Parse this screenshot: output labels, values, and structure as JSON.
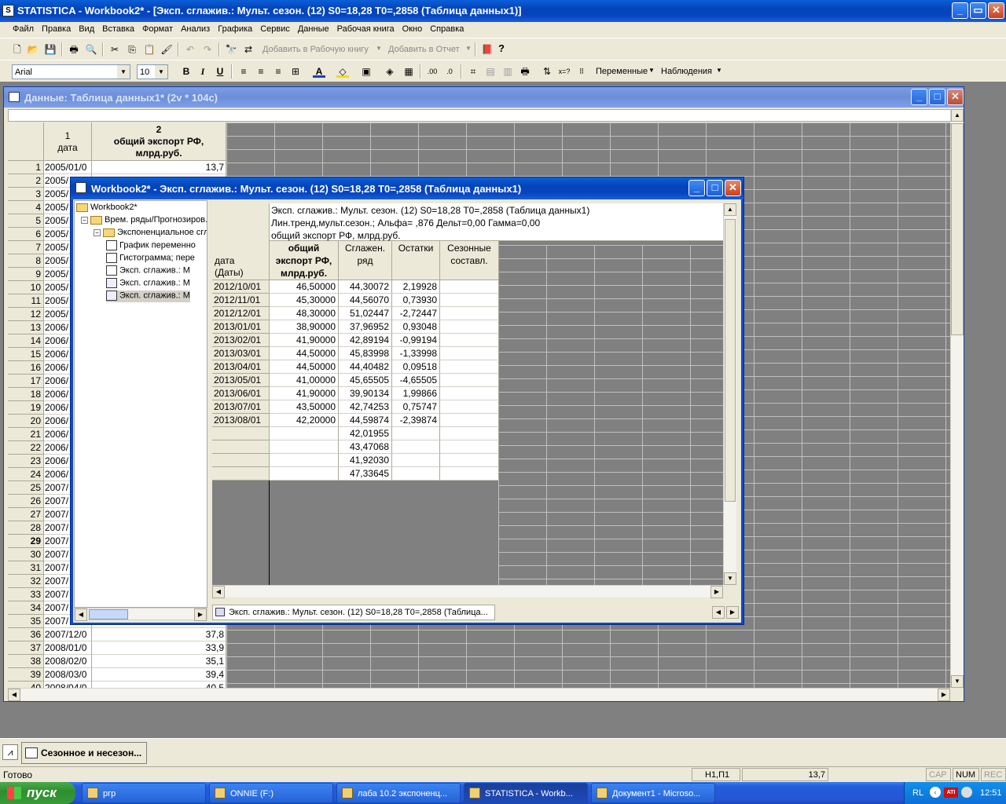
{
  "app": {
    "title": "STATISTICA - Workbook2* - [Эксп. сглажив.: Мульт. сезон. (12) S0=18,28 T0=,2858 (Таблица данных1)]"
  },
  "menu": [
    "Файл",
    "Правка",
    "Вид",
    "Вставка",
    "Формат",
    "Анализ",
    "Графика",
    "Сервис",
    "Данные",
    "Рабочая книга",
    "Окно",
    "Справка"
  ],
  "toolbar": {
    "add_workbook": "Добавить в Рабочую книгу",
    "add_report": "Добавить в Отчет",
    "font": "Arial",
    "size": "10",
    "variables": "Переменные",
    "observations": "Наблюдения",
    "help_icon": "?"
  },
  "datawin": {
    "title": "Данные: Таблица данных1* (2v * 104c)",
    "col1_num": "1",
    "col1_name": "дата",
    "col2_num": "2",
    "col2_name": "общий экспорт РФ, млрд.руб.",
    "rows": [
      [
        "1",
        "2005/01/0",
        "13,7"
      ],
      [
        "2",
        "2005/",
        ""
      ],
      [
        "3",
        "2005/",
        ""
      ],
      [
        "4",
        "2005/",
        ""
      ],
      [
        "5",
        "2005/",
        ""
      ],
      [
        "6",
        "2005/",
        ""
      ],
      [
        "7",
        "2005/",
        ""
      ],
      [
        "8",
        "2005/",
        ""
      ],
      [
        "9",
        "2005/",
        ""
      ],
      [
        "10",
        "2005/",
        ""
      ],
      [
        "11",
        "2005/",
        ""
      ],
      [
        "12",
        "2005/",
        ""
      ],
      [
        "13",
        "2006/",
        ""
      ],
      [
        "14",
        "2006/",
        ""
      ],
      [
        "15",
        "2006/",
        ""
      ],
      [
        "16",
        "2006/",
        ""
      ],
      [
        "17",
        "2006/",
        ""
      ],
      [
        "18",
        "2006/",
        ""
      ],
      [
        "19",
        "2006/",
        ""
      ],
      [
        "20",
        "2006/",
        ""
      ],
      [
        "21",
        "2006/",
        ""
      ],
      [
        "22",
        "2006/",
        ""
      ],
      [
        "23",
        "2006/",
        ""
      ],
      [
        "24",
        "2006/",
        ""
      ],
      [
        "25",
        "2007/",
        ""
      ],
      [
        "26",
        "2007/",
        ""
      ],
      [
        "27",
        "2007/",
        ""
      ],
      [
        "28",
        "2007/",
        ""
      ],
      [
        "29",
        "2007/",
        ""
      ],
      [
        "30",
        "2007/",
        ""
      ],
      [
        "31",
        "2007/",
        ""
      ],
      [
        "32",
        "2007/",
        ""
      ],
      [
        "33",
        "2007/",
        ""
      ],
      [
        "34",
        "2007/",
        ""
      ],
      [
        "35",
        "2007/",
        ""
      ],
      [
        "36",
        "2007/12/0",
        "37,8"
      ],
      [
        "37",
        "2008/01/0",
        "33,9"
      ],
      [
        "38",
        "2008/02/0",
        "35,1"
      ],
      [
        "39",
        "2008/03/0",
        "39,4"
      ],
      [
        "40",
        "2008/04/0",
        "40,5"
      ]
    ]
  },
  "workbook": {
    "title": "Workbook2* - Эксп. сглажив.: Мульт. сезон. (12) S0=18,28 T0=,2858 (Таблица данных1)",
    "tree": [
      "Workbook2*",
      "Врем. ряды/Прогнозиров.",
      "Экспоненциальное сгл",
      "График переменно",
      "Гистограмма; пере",
      "Эксп. сглажив.: М",
      "Эксп. сглажив.: М",
      "Эксп. сглажив.: М"
    ],
    "header_lines": [
      "Эксп. сглажив.: Мульт. сезон. (12) S0=18,28 T0=,2858 (Таблица данных1)",
      "Лин.тренд,мульт.сезон.; Альфа= ,876 Дельт=0,00 Гамма=0,00",
      "общий экспорт РФ, млрд.руб."
    ],
    "col_date": "дата (Даты)",
    "col_export": "общий экспорт РФ, млрд.руб.",
    "col_smooth": "Сглажен. ряд",
    "col_resid": "Остатки",
    "col_season": "Сезонные составл.",
    "rows": [
      [
        "2012/10/01",
        "46,50000",
        "44,30072",
        "2,19928"
      ],
      [
        "2012/11/01",
        "45,30000",
        "44,56070",
        "0,73930"
      ],
      [
        "2012/12/01",
        "48,30000",
        "51,02447",
        "-2,72447"
      ],
      [
        "2013/01/01",
        "38,90000",
        "37,96952",
        "0,93048"
      ],
      [
        "2013/02/01",
        "41,90000",
        "42,89194",
        "-0,99194"
      ],
      [
        "2013/03/01",
        "44,50000",
        "45,83998",
        "-1,33998"
      ],
      [
        "2013/04/01",
        "44,50000",
        "44,40482",
        "0,09518"
      ],
      [
        "2013/05/01",
        "41,00000",
        "45,65505",
        "-4,65505"
      ],
      [
        "2013/06/01",
        "41,90000",
        "39,90134",
        "1,99866"
      ],
      [
        "2013/07/01",
        "43,50000",
        "42,74253",
        "0,75747"
      ],
      [
        "2013/08/01",
        "42,20000",
        "44,59874",
        "-2,39874"
      ],
      [
        "",
        "",
        "42,01955",
        ""
      ],
      [
        "",
        "",
        "43,47068",
        ""
      ],
      [
        "",
        "",
        "41,92030",
        ""
      ],
      [
        "",
        "",
        "47,33645",
        ""
      ]
    ],
    "tab": "Эксп. сглажив.: Мульт. сезон. (12) S0=18,28 T0=,2858 (Таблица..."
  },
  "bottom": {
    "task_label": "Сезонное и несезон...",
    "status": "Готово",
    "pos": "Н1,П1",
    "value": "13,7",
    "cap": "CAP",
    "num": "NUM",
    "rec": "REC"
  },
  "taskbar": {
    "start": "пуск",
    "items": [
      "ргр",
      "ONNIE (F:)",
      "лаба 10.2 экспоненц...",
      "STATISTICA - Workb...",
      "Документ1 - Microso..."
    ],
    "lang": "RL",
    "time": "12:51"
  }
}
